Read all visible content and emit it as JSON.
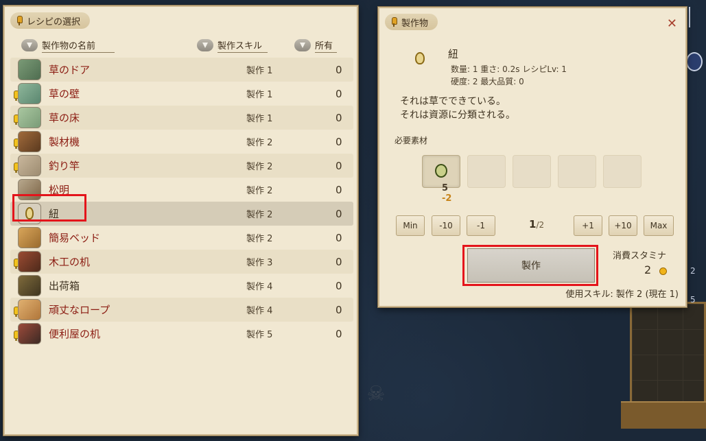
{
  "recipe_panel": {
    "title": "レシピの選択",
    "columns": {
      "name": "製作物の名前",
      "skill": "製作スキル",
      "owned": "所有"
    },
    "rows": [
      {
        "name": "草のドア",
        "skill": "製作 1",
        "owned": "0",
        "warn": false,
        "unlocked": true,
        "icon": "grass-door-icon"
      },
      {
        "name": "草の壁",
        "skill": "製作 1",
        "owned": "0",
        "warn": true,
        "unlocked": true,
        "icon": "grass-wall-icon"
      },
      {
        "name": "草の床",
        "skill": "製作 1",
        "owned": "0",
        "warn": true,
        "unlocked": true,
        "icon": "grass-floor-icon"
      },
      {
        "name": "製材機",
        "skill": "製作 2",
        "owned": "0",
        "warn": true,
        "unlocked": false,
        "icon": "sawmill-icon"
      },
      {
        "name": "釣り竿",
        "skill": "製作 2",
        "owned": "0",
        "warn": true,
        "unlocked": false,
        "icon": "fishing-rod-icon"
      },
      {
        "name": "松明",
        "skill": "製作 2",
        "owned": "0",
        "warn": false,
        "unlocked": true,
        "icon": "torch-icon"
      },
      {
        "name": "紐",
        "skill": "製作 2",
        "owned": "0",
        "warn": false,
        "unlocked": true,
        "selected": true,
        "icon": "string-icon"
      },
      {
        "name": "簡易ベッド",
        "skill": "製作 2",
        "owned": "0",
        "warn": false,
        "unlocked": false,
        "icon": "simple-bed-icon"
      },
      {
        "name": "木工の机",
        "skill": "製作 3",
        "owned": "0",
        "warn": true,
        "unlocked": false,
        "icon": "carpentry-desk-icon"
      },
      {
        "name": "出荷箱",
        "skill": "製作 4",
        "owned": "0",
        "warn": false,
        "unlocked": true,
        "icon": "shipping-box-icon"
      },
      {
        "name": "頑丈なロープ",
        "skill": "製作 4",
        "owned": "0",
        "warn": true,
        "unlocked": false,
        "icon": "sturdy-rope-icon"
      },
      {
        "name": "便利屋の机",
        "skill": "製作 5",
        "owned": "0",
        "warn": true,
        "unlocked": false,
        "icon": "handyman-desk-icon"
      }
    ]
  },
  "craft_panel": {
    "title": "製作物",
    "close": "✕",
    "item": {
      "name": "紐",
      "stats_line1": "数量: 1  重さ: 0.2s  レシピLv: 1",
      "stats_line2": "硬度: 2  最大品質: 0",
      "desc_line1": "それは草でできている。",
      "desc_line2": "それは資源に分類される。"
    },
    "materials_label": "必要素材",
    "material_have": "5",
    "material_need": "-2",
    "buttons": {
      "min": "Min",
      "minus10": "-10",
      "minus1": "-1",
      "plus1": "+1",
      "plus10": "+10",
      "max": "Max",
      "craft": "製作"
    },
    "quantity_current": "1",
    "quantity_total": "/2",
    "stamina_label": "消費スタミナ",
    "stamina_value": "2",
    "skill_use": "使用スキル: 製作 2 (現在 1)"
  },
  "world": {
    "side_numbers": [
      "2",
      "5"
    ]
  },
  "colors": {
    "panel_bg": "#f1e8d2",
    "locked_text": "#8b1c12",
    "highlight": "#e4141b"
  }
}
